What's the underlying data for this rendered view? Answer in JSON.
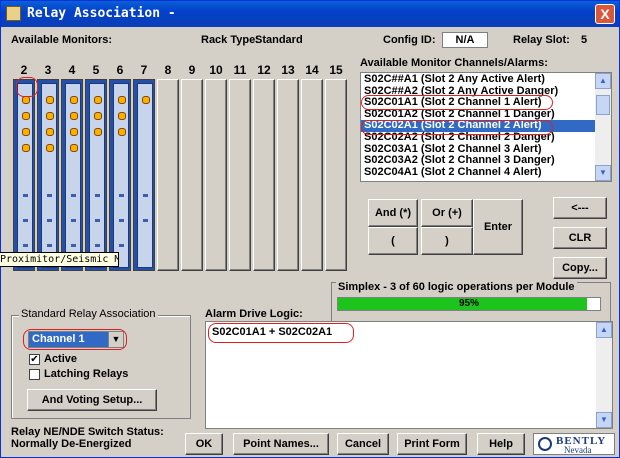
{
  "window": {
    "title": "Relay Association -",
    "close": "X"
  },
  "header": {
    "available_monitors": "Available Monitors:",
    "rack_type_label": "Rack Type:",
    "rack_type_value": "Standard",
    "config_id_label": "Config ID:",
    "config_id_value": "N/A",
    "relay_slot_label": "Relay Slot:",
    "relay_slot_value": "5"
  },
  "rack": {
    "slot_numbers": [
      "2",
      "3",
      "4",
      "5",
      "6",
      "7",
      "8",
      "9",
      "10",
      "11",
      "12",
      "13",
      "14",
      "15"
    ],
    "tooltip": "Proximitor/Seismic Mon"
  },
  "channels": {
    "label": "Available Monitor Channels/Alarms:",
    "items": [
      "S02C##A1 (Slot 2 Any Active Alert)",
      "S02C##A2 (Slot 2 Any Active Danger)",
      "S02C01A1 (Slot 2 Channel 1 Alert)",
      "S02C01A2 (Slot 2 Channel 1 Danger)",
      "S02C02A1 (Slot 2 Channel 2 Alert)",
      "S02C02A2 (Slot 2 Channel 2 Danger)",
      "S02C03A1 (Slot 2 Channel 3 Alert)",
      "S02C03A2 (Slot 2 Channel 3 Danger)",
      "S02C04A1 (Slot 2 Channel 4 Alert)"
    ],
    "selected_index": 4
  },
  "logic_buttons": {
    "and": "And (*)",
    "or": "Or (+)",
    "open_paren": "(",
    "close_paren": ")",
    "enter": "Enter",
    "back": "<---",
    "clr": "CLR",
    "copy": "Copy..."
  },
  "simplex": {
    "label": "Simplex - 3 of 60 logic operations per Module",
    "percent": 95,
    "percent_text": "95%"
  },
  "relay_assoc": {
    "label": "Standard Relay Association",
    "channel": "Channel 1",
    "active_label": "Active",
    "active_checked": true,
    "latching_label": "Latching Relays",
    "latching_checked": false,
    "voting_button": "And Voting Setup..."
  },
  "alarm_logic": {
    "label": "Alarm Drive Logic:",
    "value": "S02C01A1 + S02C02A1"
  },
  "status": {
    "line1": "Relay NE/NDE Switch Status:",
    "line2": "Normally De-Energized"
  },
  "footer": {
    "ok": "OK",
    "point_names": "Point Names...",
    "cancel": "Cancel",
    "print_form": "Print Form",
    "help": "Help"
  },
  "logo": {
    "brand": "BENTLY",
    "sub": "Nevada"
  },
  "colors": {
    "title_bar": "#0340c9",
    "selection": "#316ac5",
    "progress": "#1ec41e",
    "annotation": "#e02020"
  }
}
